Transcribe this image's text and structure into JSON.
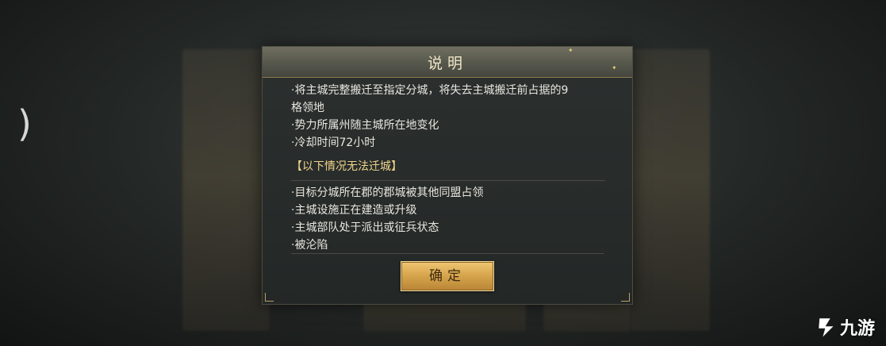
{
  "dialog": {
    "title": "说明",
    "lines": [
      "·将主城完整搬迁至指定分城，将失去主城搬迁前占据的9",
      "格领地",
      "·势力所属州随主城所在地变化",
      "·冷却时间72小时"
    ],
    "section_title": "【以下情况无法迁城】",
    "conditions": [
      "·目标分城所在郡的郡城被其他同盟占领",
      "·主城设施正在建造或升级",
      "·主城部队处于派出或征兵状态",
      "·被沦陷"
    ],
    "confirm_label": "确定"
  },
  "background": {
    "nav_arrow": ")"
  },
  "watermark": {
    "text": "九游",
    "icon": "jiuyou-logo-icon"
  },
  "colors": {
    "accent_gold": "#f0d58a",
    "button_gold": "#d8a64e",
    "text": "#e8e6df"
  }
}
